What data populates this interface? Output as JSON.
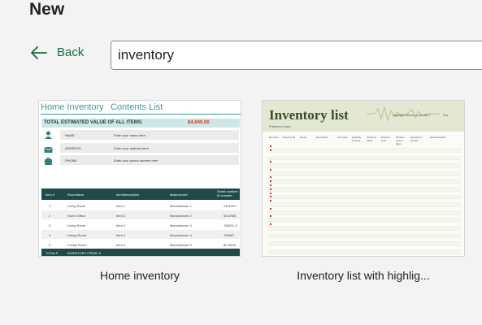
{
  "page": {
    "title": "New"
  },
  "nav": {
    "back_label": "Back"
  },
  "search": {
    "value": "inventory"
  },
  "templates": [
    {
      "caption": "Home inventory",
      "preview": {
        "tab_1": "Home Inventory",
        "tab_2": "Contents List",
        "total_label": "TOTAL ESTIMATED VALUE OF ALL ITEMS:",
        "total_value": "$4,040.00",
        "fields": [
          {
            "label": "NAME:",
            "value": "Enter your name here"
          },
          {
            "label": "ADDRESS:",
            "value": "Enter your address here"
          },
          {
            "label": "PHONE:",
            "value": "Enter your phone number here"
          }
        ],
        "columns": [
          "Item #",
          "Room/area",
          "Item/description",
          "Make/model",
          "Serial number/ ID number"
        ],
        "rows": [
          [
            "1",
            "Living Room",
            "Item 1",
            "Manufacturer 1",
            "2341943"
          ],
          [
            "2",
            "Home Office",
            "Item 2",
            "Manufacturer 2",
            "55-6788"
          ],
          [
            "3",
            "Living Room",
            "Item 3",
            "Manufacturer 3",
            "788331-0"
          ],
          [
            "4",
            "Dining Room",
            "Item 4",
            "Manufacturer 4",
            "756687"
          ],
          [
            "5",
            "Family Room",
            "Item 5",
            "Manufacturer 5",
            "80-3008"
          ]
        ],
        "footer_label": "TOTALS",
        "footer_items": "INVENTORY ITEMS: 5"
      }
    },
    {
      "caption": "Inventory list with highlig...",
      "preview": {
        "title": "Inventory list",
        "subtitle": "Preferred Labs",
        "highlight_label": "Highlight items to reorder?",
        "highlight_value": "Yes",
        "columns": [
          "Re-order",
          "Inventory ID",
          "Name",
          "Description",
          "Unit price",
          "Quantity in stock",
          "Inventory value",
          "Reorder level",
          "Reorder time in days",
          "Quantity in reorder",
          "Discontinued?"
        ]
      }
    }
  ]
}
